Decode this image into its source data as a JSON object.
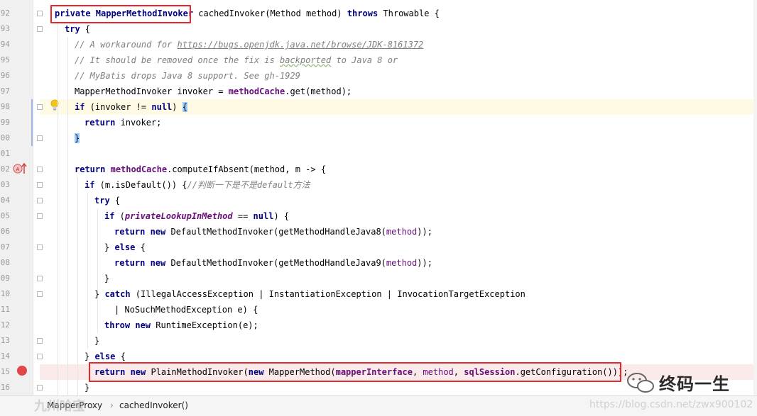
{
  "editor": {
    "line_numbers": [
      "92",
      "93",
      "94",
      "95",
      "96",
      "97",
      "98",
      "99",
      "00",
      "01",
      "02",
      "03",
      "04",
      "05",
      "06",
      "07",
      "08",
      "09",
      "10",
      "11",
      "12",
      "13",
      "14",
      "15",
      "16"
    ],
    "code": {
      "l92a": "private MapperMethodInvoker",
      "l92b": " cachedInvoker(Method method) ",
      "l92c": "throws",
      "l92d": " Throwable {",
      "l93": "try",
      "l93b": " {",
      "l94a": "// A workaround for ",
      "l94b": "https://bugs.openjdk.java.net/browse/JDK-8161372",
      "l95a": "// It should be removed once the fix is ",
      "l95b": "backported",
      "l95c": " to Java 8 or",
      "l96": "// MyBatis drops Java 8 support. See gh-1929",
      "l97a": "MapperMethodInvoker invoker = ",
      "l97b": "methodCache",
      "l97c": ".get(method);",
      "l98a": "if",
      "l98b": " (invoker != ",
      "l98c": "null",
      "l98d": ") ",
      "l98e": "{",
      "l99a": "return",
      "l99b": " invoker;",
      "l100": "}",
      "l102a": "return",
      "l102b": "methodCache",
      "l102c": ".computeIfAbsent(method, m -> {",
      "l103a": "if",
      "l103b": " (m.isDefault()) {",
      "l103c": "//判断一下是不是",
      "l103d": "default",
      "l103e": "方法",
      "l104a": "try",
      "l104b": " {",
      "l105a": "if",
      "l105b": " (",
      "l105c": "privateLookupInMethod",
      "l105d": " == ",
      "l105e": "null",
      "l105f": ") {",
      "l106a": "return new",
      "l106b": " DefaultMethodInvoker(getMethodHandleJava8(",
      "l106c": "method",
      "l106d": "));",
      "l107a": "} ",
      "l107b": "else",
      "l107c": " {",
      "l108a": "return new",
      "l108b": " DefaultMethodInvoker(getMethodHandleJava9(",
      "l108c": "method",
      "l108d": "));",
      "l109": "}",
      "l110a": "} ",
      "l110b": "catch",
      "l110c": " (IllegalAccessException | InstantiationException | InvocationTargetException",
      "l111": "| NoSuchMethodException e) {",
      "l112a": "throw new",
      "l112b": " RuntimeException(e);",
      "l113": "}",
      "l114a": "} ",
      "l114b": "else",
      "l114c": " {",
      "l115a": "return new",
      "l115b": " PlainMethodInvoker(",
      "l115c": "new",
      "l115d": " MapperMethod(",
      "l115e": "mapperInterface",
      "l115f": ", ",
      "l115g": "method",
      "l115h": ", ",
      "l115i": "sqlSession",
      "l115j": ".getConfiguration()));",
      "l116": "}"
    }
  },
  "breadcrumb": {
    "class_name": "MapperProxy",
    "separator": "›",
    "method_name": "cachedInvoker()"
  },
  "watermarks": {
    "wechat_account": "终码一生",
    "csdn_url": "https://blog.csdn.net/zwx900102",
    "bottom_left": "九州哈宝"
  },
  "colors": {
    "keyword": "#000080",
    "comment": "#808080",
    "field": "#660e7a",
    "highlight_box": "#e8262a",
    "current_line": "#fffae3",
    "breakpoint_line": "#faeaea"
  },
  "icons": {
    "intention": "lightbulb-icon",
    "breakpoint": "breakpoint-icon",
    "override": "override-marker-icon",
    "wechat": "wechat-icon"
  }
}
